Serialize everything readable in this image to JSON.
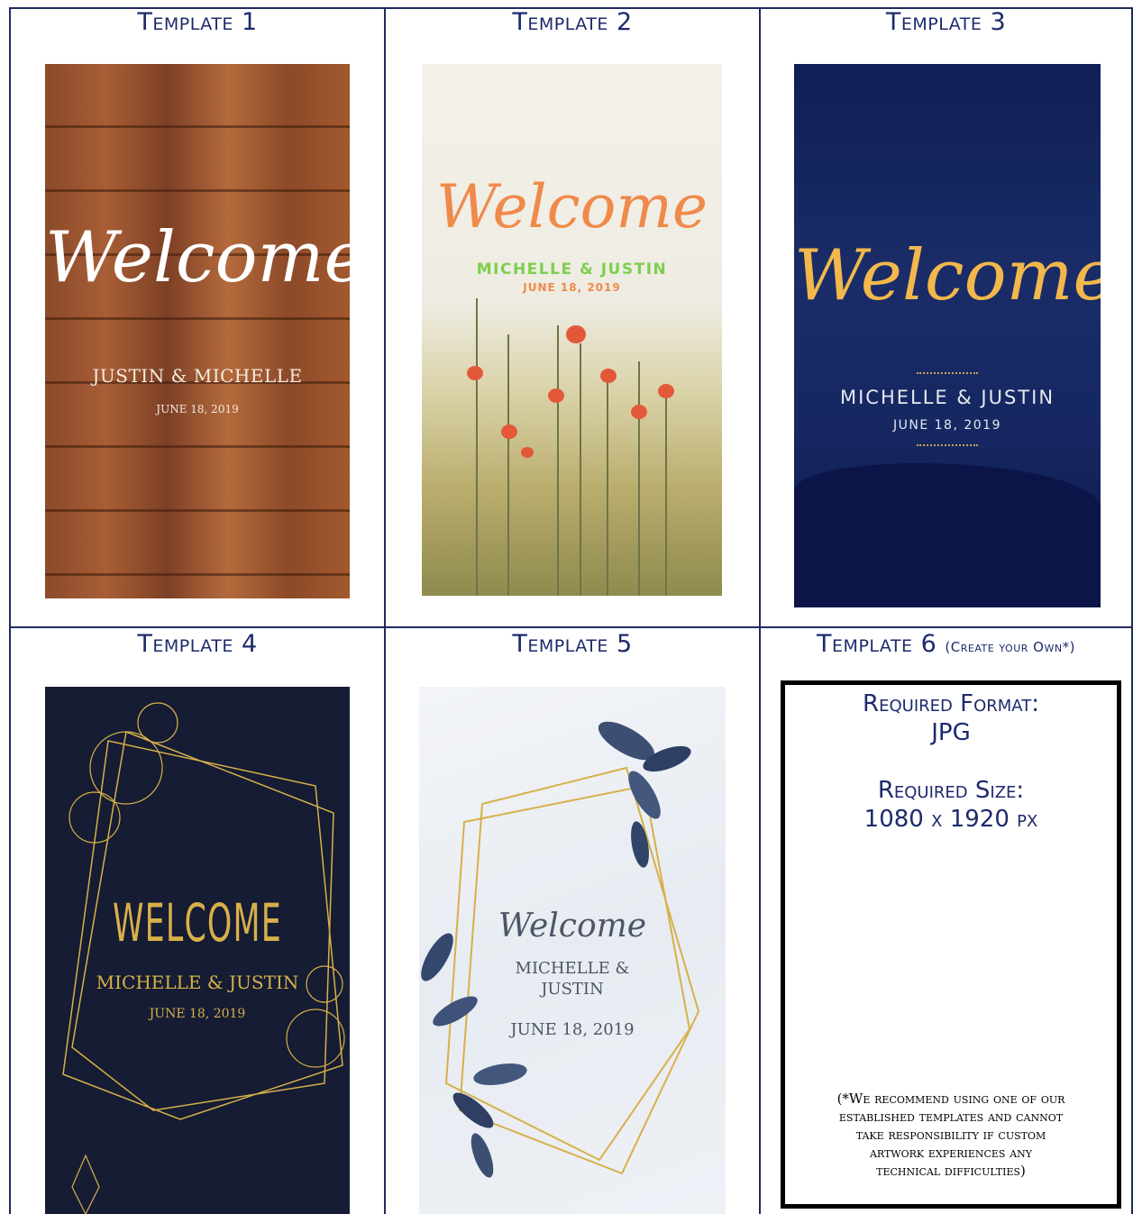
{
  "templates": [
    {
      "header": "Template 1",
      "welcome": "Welcome",
      "names": "JUSTIN & MICHELLE",
      "date": "JUNE 18, 2019"
    },
    {
      "header": "Template 2",
      "welcome": "Welcome",
      "names": "MICHELLE & JUSTIN",
      "date": "JUNE 18, 2019"
    },
    {
      "header": "Template 3",
      "welcome": "Welcome",
      "names": "MICHELLE & JUSTIN",
      "date": "JUNE 18, 2019"
    },
    {
      "header": "Template 4",
      "welcome": "WELCOME",
      "names": "MICHELLE & JUSTIN",
      "date": "JUNE 18, 2019"
    },
    {
      "header": "Template 5",
      "welcome": "Welcome",
      "names_line1": "MICHELLE &",
      "names_line2": "JUSTIN",
      "date": "JUNE 18, 2019"
    },
    {
      "header": "Template 6",
      "header_sub": "(Create your Own*)",
      "format_label": "Required Format:",
      "format_value": "JPG",
      "size_label": "Required Size:",
      "size_value": "1080 x 1920 px",
      "disclaimer": [
        "(*We recommend using one of our",
        "established templates and cannot",
        "take responsibility if custom",
        "artwork experiences any",
        "technical difficulties)"
      ]
    }
  ],
  "colors": {
    "border": "#1f2b5c",
    "header_text": "#1d2a6b",
    "t2_welcome": "#f08a4b",
    "t2_names": "#7ccf4e",
    "t3_welcome": "#f2b84b",
    "gold": "#d8b04a"
  }
}
